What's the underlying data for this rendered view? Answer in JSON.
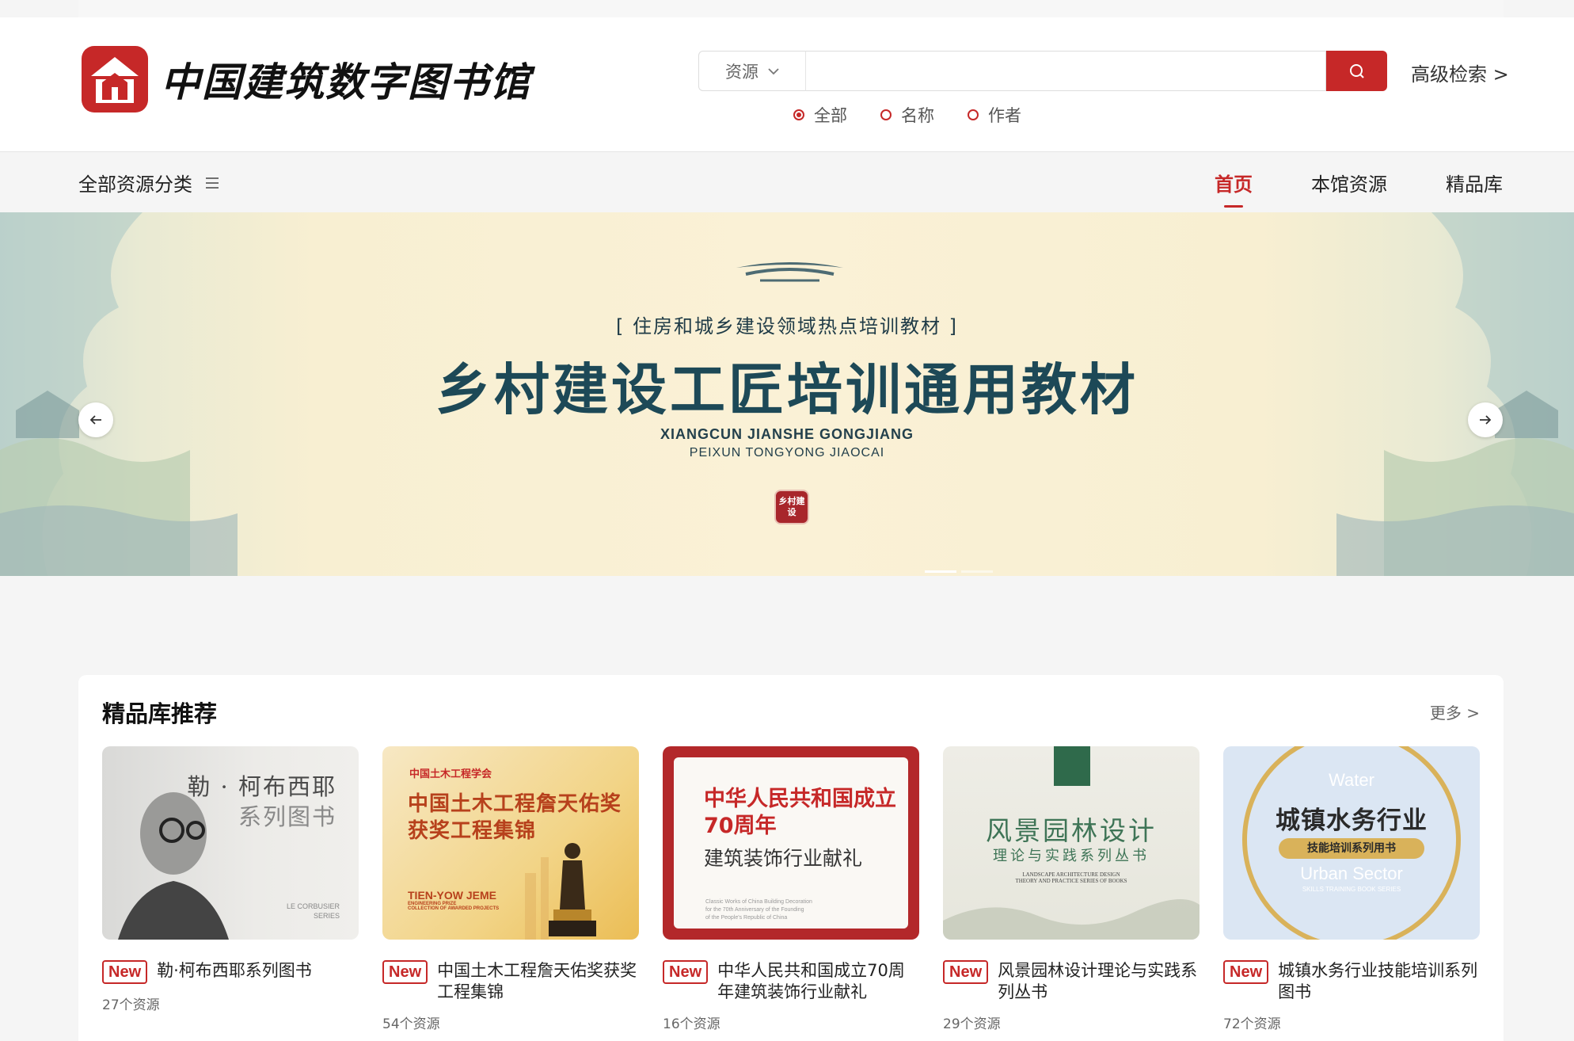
{
  "brand": {
    "logo_text": "中国建筑数字图书馆"
  },
  "search": {
    "scope_label": "资源",
    "query": "",
    "placeholder": "",
    "advanced_label": "高级检索 >",
    "filters": [
      {
        "label": "全部",
        "selected": true
      },
      {
        "label": "名称",
        "selected": false
      },
      {
        "label": "作者",
        "selected": false
      }
    ]
  },
  "nav": {
    "all_categories": "全部资源分类",
    "links": [
      {
        "label": "首页",
        "active": true
      },
      {
        "label": "本馆资源",
        "active": false
      },
      {
        "label": "精品库",
        "active": false
      }
    ]
  },
  "banner": {
    "subtitle": "[ 住房和城乡建设领域热点培训教材 ]",
    "title": "乡村建设工匠培训通用教材",
    "en_line1": "XIANGCUN JIANSHE GONGJIANG",
    "en_line2": "PEIXUN TONGYONG JIAOCAI",
    "seal_text": "乡村建设"
  },
  "featured": {
    "title": "精品库推荐",
    "more_label": "更多 >",
    "badge_label": "New",
    "items": [
      {
        "title": "勒·柯布西耶系列图书",
        "count": "27个资源",
        "cover": {
          "line1": "勒 · 柯布西耶",
          "line2": "系列图书",
          "en1": "LE CORBUSIER",
          "en2": "SERIES"
        }
      },
      {
        "title": "中国土木工程詹天佑奖获奖工程集锦",
        "count": "54个资源",
        "cover": {
          "org": "中国土木工程学会",
          "line1": "中国土木工程詹天佑奖",
          "line2": "获奖工程集锦",
          "en1": "TIEN-YOW JEME",
          "en2": "ENGINEERING PRIZE",
          "en3": "COLLECTION OF AWARDED PROJECTS"
        }
      },
      {
        "title": "中华人民共和国成立70周年建筑装饰行业献礼",
        "count": "16个资源",
        "cover": {
          "line1": "中华人民共和国成立",
          "line2": "70周年",
          "line3": "建筑装饰行业献礼",
          "en1": "Classic Works of China Building Decoration",
          "en2": "for the 70th Anniversary of the Founding",
          "en3": "of the People's Republic of China"
        }
      },
      {
        "title": "风景园林设计理论与实践系列丛书",
        "count": "29个资源",
        "cover": {
          "line1": "风景园林设计",
          "line2": "理论与实践系列丛书",
          "en1": "LANDSCAPE ARCHITECTURE DESIGN",
          "en2": "THEORY AND PRACTICE SERIES OF BOOKS"
        }
      },
      {
        "title": "城镇水务行业技能培训系列图书",
        "count": "72个资源",
        "cover": {
          "w": "Water",
          "line1": "城镇水务行业",
          "pill": "技能培训系列用书",
          "u": "Urban Sector",
          "s": "SKILLS TRAINING BOOK SERIES"
        }
      }
    ]
  },
  "colors": {
    "accent": "#c62828",
    "banner_title": "#1d4957"
  }
}
